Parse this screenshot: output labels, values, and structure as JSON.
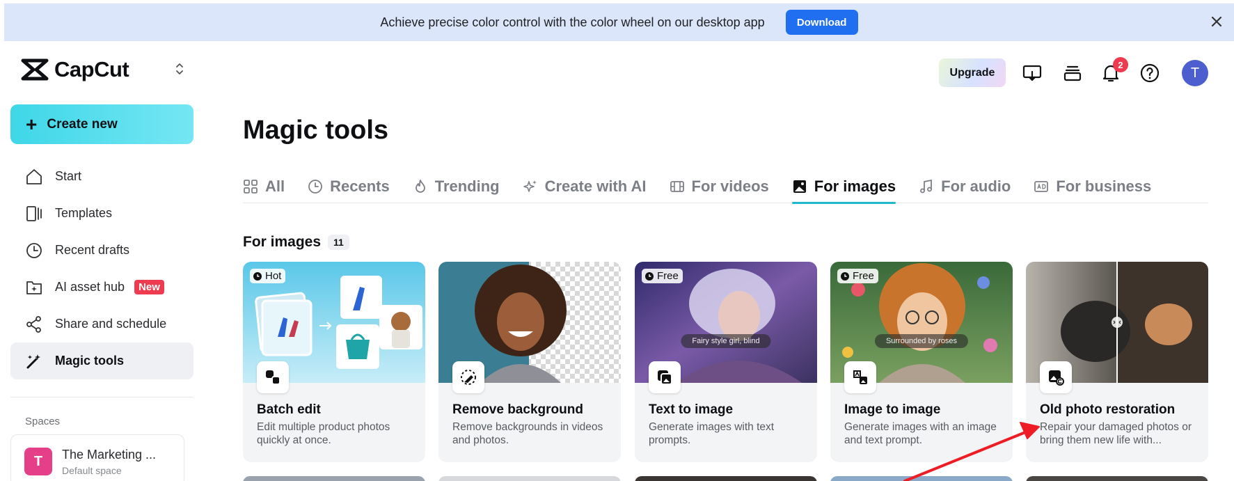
{
  "banner": {
    "text": "Achieve precise color control with the color wheel on our desktop app",
    "button": "Download"
  },
  "app": {
    "name": "CapCut"
  },
  "header": {
    "upgrade": "Upgrade",
    "notification_count": "2",
    "avatar_initial": "T"
  },
  "sidebar": {
    "create_new": "Create new",
    "items": [
      {
        "label": "Start",
        "icon": "home-icon"
      },
      {
        "label": "Templates",
        "icon": "templates-icon"
      },
      {
        "label": "Recent drafts",
        "icon": "clock-icon"
      },
      {
        "label": "AI asset hub",
        "icon": "asset-hub-icon",
        "badge": "New"
      },
      {
        "label": "Share and schedule",
        "icon": "share-icon"
      },
      {
        "label": "Magic tools",
        "icon": "magic-wand-icon",
        "active": true
      }
    ],
    "spaces_label": "Spaces",
    "space": {
      "initial": "T",
      "name": "The Marketing ...",
      "sub": "Default space"
    }
  },
  "main": {
    "title": "Magic tools",
    "tabs": [
      {
        "label": "All"
      },
      {
        "label": "Recents"
      },
      {
        "label": "Trending"
      },
      {
        "label": "Create with AI"
      },
      {
        "label": "For videos"
      },
      {
        "label": "For images",
        "active": true
      },
      {
        "label": "For audio"
      },
      {
        "label": "For business"
      }
    ],
    "section_title": "For images",
    "section_count": "11",
    "cards": [
      {
        "title": "Batch edit",
        "desc": "Edit multiple product photos quickly at once.",
        "tag": "Hot"
      },
      {
        "title": "Remove background",
        "desc": "Remove backgrounds in videos and photos."
      },
      {
        "title": "Text to image",
        "desc": "Generate images with text prompts.",
        "tag": "Free",
        "caption": "Fairy style girl, blind"
      },
      {
        "title": "Image to image",
        "desc": "Generate images with an image and text prompt.",
        "tag": "Free",
        "caption": "Surrounded by roses"
      },
      {
        "title": "Old photo restoration",
        "desc": "Repair your damaged photos or bring them new life with..."
      }
    ]
  },
  "colors": {
    "accent": "#1fb8cc",
    "banner_bg": "#dbe6fb",
    "download": "#1f6ff0",
    "annotation_arrow": "#ee1c24"
  }
}
